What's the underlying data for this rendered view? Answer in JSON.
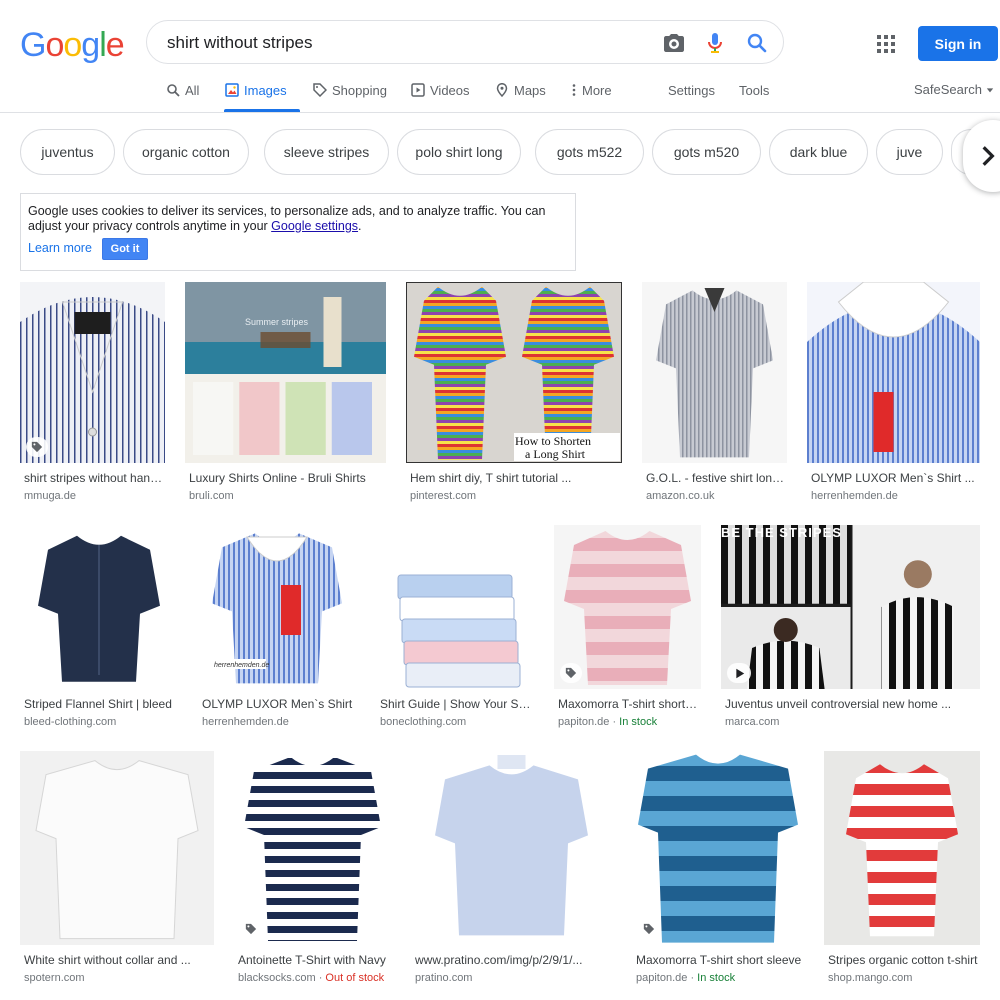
{
  "header": {
    "logo_letters": [
      {
        "ch": "G",
        "color": "#4285f4"
      },
      {
        "ch": "o",
        "color": "#ea4335"
      },
      {
        "ch": "o",
        "color": "#fbbc05"
      },
      {
        "ch": "g",
        "color": "#4285f4"
      },
      {
        "ch": "l",
        "color": "#34a853"
      },
      {
        "ch": "e",
        "color": "#ea4335"
      }
    ],
    "search_query": "shirt without stripes",
    "icons": [
      "camera-icon",
      "microphone-icon",
      "search-icon",
      "apps-grid-icon"
    ],
    "signin_label": "Sign in"
  },
  "tabs": {
    "all": "All",
    "images": "Images",
    "shopping": "Shopping",
    "videos": "Videos",
    "maps": "Maps",
    "more": "More",
    "settings": "Settings",
    "tools": "Tools",
    "safesearch": "SafeSearch"
  },
  "chips": [
    "juventus",
    "organic cotton",
    "sleeve stripes",
    "polo shirt long",
    "gots m522",
    "gots m520",
    "dark blue",
    "juve"
  ],
  "cookie": {
    "text_before": "Google uses cookies to deliver its services, to personalize ads, and to analyze traffic. You can adjust your privacy controls anytime in your ",
    "settings_link": "Google settings",
    "text_after": ".",
    "learn_more": "Learn more",
    "got_it": "Got it"
  },
  "results": [
    {
      "title": "shirt stripes without handkerchief",
      "source": "mmuga.de",
      "stock": ""
    },
    {
      "title": "Luxury Shirts Online - Bruli Shirts",
      "source": "bruli.com",
      "stock": ""
    },
    {
      "title": "Hem shirt diy, T shirt tutorial ...",
      "source": "pinterest.com",
      "stock": ""
    },
    {
      "title": "G.O.L. - festive shirt long sleeve",
      "source": "amazon.co.uk",
      "stock": ""
    },
    {
      "title": "OLYMP LUXOR Men`s Shirt ...",
      "source": "herrenhemden.de",
      "stock": ""
    },
    {
      "title": "Striped Flannel Shirt | bleed",
      "source": "bleed-clothing.com",
      "stock": ""
    },
    {
      "title": "OLYMP LUXOR Men`s Shirt",
      "source": "herrenhemden.de",
      "stock": ""
    },
    {
      "title": "Shirt Guide | Show Your Style",
      "source": "boneclothing.com",
      "stock": ""
    },
    {
      "title": "Maxomorra T-shirt short sleeve",
      "source": "papiton.de",
      "stock": "In stock",
      "stock_type": "in"
    },
    {
      "title": "Juventus unveil controversial new home ...",
      "source": "marca.com",
      "stock": ""
    },
    {
      "title": "White shirt without collar and ...",
      "source": "spotern.com",
      "stock": ""
    },
    {
      "title": "Antoinette T-Shirt with Navy",
      "source": "blacksocks.com",
      "stock": "Out of stock",
      "stock_type": "out"
    },
    {
      "title": "www.pratino.com/img/p/2/9/1/...",
      "source": "pratino.com",
      "stock": ""
    },
    {
      "title": "Maxomorra T-shirt short sleeve",
      "source": "papiton.de",
      "stock": "In stock",
      "stock_type": "in"
    },
    {
      "title": "Stripes organic cotton t-shirt",
      "source": "shop.mango.com",
      "stock": ""
    }
  ],
  "image_captions": {
    "bruli_overlay": "Summer stripes",
    "pinterest_caption_line1": "How to Shorten",
    "pinterest_caption_line2": "a Long Shirt",
    "juventus_banner": "BE THE STRIPES",
    "herrenhemden_watermark": "herrenhemden.de"
  },
  "colors": {
    "accent": "#1a73e8",
    "in_stock": "#188038",
    "out_of_stock": "#d93025"
  }
}
